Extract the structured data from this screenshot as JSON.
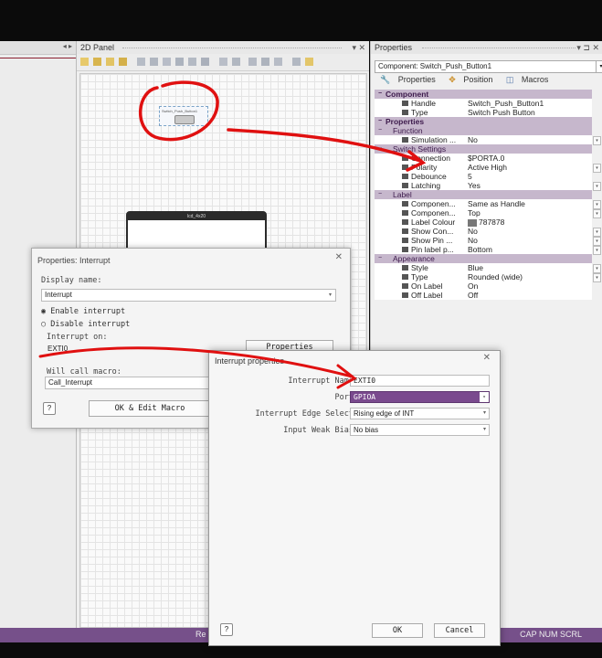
{
  "panel2d": {
    "title": "2D Panel"
  },
  "canvas": {
    "switch_label": "Switch_Push_Button1",
    "lcd_label": "lcd_4x20"
  },
  "properties": {
    "title": "Properties",
    "component_select": "Component: Switch_Push_Button1",
    "tabs": [
      "Properties",
      "Position",
      "Macros"
    ],
    "rows": [
      {
        "kind": "cat",
        "name": "Component",
        "value": ""
      },
      {
        "kind": "item",
        "name": "Handle",
        "value": "Switch_Push_Button1"
      },
      {
        "kind": "item",
        "name": "Type",
        "value": "Switch Push Button"
      },
      {
        "kind": "cat",
        "name": "Properties",
        "value": ""
      },
      {
        "kind": "sub",
        "name": "Function",
        "value": ""
      },
      {
        "kind": "item",
        "name": "Simulation ...",
        "value": "No",
        "dropdown": true
      },
      {
        "kind": "sub",
        "name": "Switch Settings",
        "value": ""
      },
      {
        "kind": "item",
        "name": "Connection",
        "value": "$PORTA.0"
      },
      {
        "kind": "item",
        "name": "Polarity",
        "value": "Active High",
        "dropdown": true
      },
      {
        "kind": "item",
        "name": "Debounce",
        "value": "5"
      },
      {
        "kind": "item",
        "name": "Latching",
        "value": "Yes",
        "dropdown": true
      },
      {
        "kind": "sub",
        "name": "Label",
        "value": ""
      },
      {
        "kind": "item",
        "name": "Componen...",
        "value": "Same as Handle",
        "dropdown": true
      },
      {
        "kind": "item",
        "name": "Componen...",
        "value": "Top",
        "dropdown": true
      },
      {
        "kind": "item",
        "name": "Label Colour",
        "value": "787878",
        "swatch": true
      },
      {
        "kind": "item",
        "name": "Show Con...",
        "value": "No",
        "dropdown": true
      },
      {
        "kind": "item",
        "name": "Show Pin ...",
        "value": "No",
        "dropdown": true
      },
      {
        "kind": "item",
        "name": "Pin label p...",
        "value": "Bottom",
        "dropdown": true
      },
      {
        "kind": "sub",
        "name": "Appearance",
        "value": ""
      },
      {
        "kind": "item",
        "name": "Style",
        "value": "Blue",
        "dropdown": true
      },
      {
        "kind": "item",
        "name": "Type",
        "value": "Rounded (wide)",
        "dropdown": true
      },
      {
        "kind": "item",
        "name": "On Label",
        "value": "On"
      },
      {
        "kind": "item",
        "name": "Off Label",
        "value": "Off"
      }
    ]
  },
  "interrupt_dialog": {
    "title": "Properties: Interrupt",
    "display_name_label": "Display name:",
    "display_name_value": "Interrupt",
    "enable_label": "Enable interrupt",
    "disable_label": "Disable interrupt",
    "interrupt_on_label": "Interrupt on:",
    "interrupt_on_value": "EXTI0",
    "properties_button": "Properties",
    "will_call_label": "Will call macro:",
    "will_call_value": "Call_Interrupt",
    "ok_edit_button": "OK & Edit Macro"
  },
  "interrupt_props_dialog": {
    "title": "Interrupt properties",
    "name_label": "Interrupt Name",
    "name_value": "EXTI0",
    "port_label": "Port",
    "port_value": "GPIOA",
    "edge_label": "Interrupt Edge Select",
    "edge_value": "Rising edge of INT",
    "bias_label": "Input Weak Bias",
    "bias_value": "No bias",
    "ok_button": "OK",
    "cancel_button": "Cancel"
  },
  "statusbar": {
    "left_text": "Re",
    "right_text": "CAP NUM SCRL"
  },
  "colors": {
    "accent": "#76508a",
    "category": "#c6b7cc",
    "annotation": "#e01010",
    "highlight_select": "#7a4a8e"
  }
}
